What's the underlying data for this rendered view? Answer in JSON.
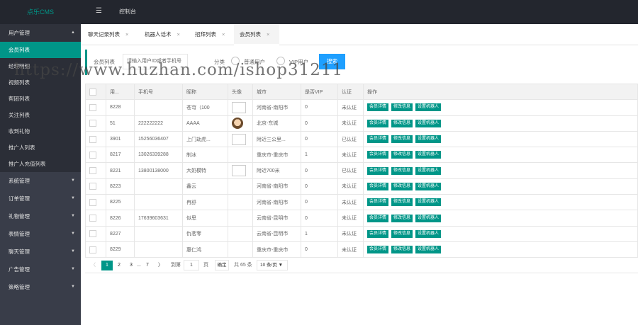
{
  "app": {
    "logo": "点乐CMS",
    "menu_icon": "☰",
    "nav_label": "控制台"
  },
  "sidebar": {
    "groups": [
      {
        "label": "用户管理",
        "open": true,
        "subs": [
          "会员列表",
          "经理明细",
          "视频列表",
          "帮团列表",
          "关注列表",
          "收到礼物",
          "推广人列表",
          "推广人充值列表"
        ]
      },
      {
        "label": "系统管理"
      },
      {
        "label": "订单管理"
      },
      {
        "label": "礼物管理"
      },
      {
        "label": "表情管理"
      },
      {
        "label": "聊天管理"
      },
      {
        "label": "广告管理"
      },
      {
        "label": "策略管理"
      }
    ]
  },
  "tabs": [
    {
      "label": "聊天记录列表",
      "close": "×"
    },
    {
      "label": "机器人话术",
      "close": "×"
    },
    {
      "label": "招拜列表",
      "close": "×"
    },
    {
      "label": "会员列表",
      "close": "×",
      "active": true
    }
  ],
  "filter": {
    "title": "会员列表",
    "placeholder": "请输入用户ID或者手机号",
    "category_label": "分类",
    "option1": "普通用户",
    "option2": "VIP用户",
    "search_btn": "搜索"
  },
  "table": {
    "headers": [
      "用...",
      "手机号",
      "昵称",
      "头像",
      "城市",
      "是否VIP",
      "认证",
      "操作"
    ],
    "actions": [
      "会员详情",
      "修改信息",
      "设置机器人"
    ],
    "rows": [
      {
        "id": "8228",
        "phone": "",
        "nick": "苍穹（100",
        "avatar": "box",
        "city": "河南省-南阳市",
        "vip": "0",
        "auth": "未认证"
      },
      {
        "id": "51",
        "phone": "222222222",
        "nick": "AAAA",
        "avatar": "face",
        "city": "北京-东城",
        "vip": "0",
        "auth": "未认证"
      },
      {
        "id": "3901",
        "phone": "15256036407",
        "nick": "上门劫虎...",
        "avatar": "box",
        "city": "附近三公里...",
        "vip": "0",
        "auth": "已认证"
      },
      {
        "id": "8217",
        "phone": "13026339288",
        "nick": "制冰",
        "avatar": "",
        "city": "重庆市-重庆市",
        "vip": "1",
        "auth": "未认证"
      },
      {
        "id": "8221",
        "phone": "13800138000",
        "nick": "大奶模特",
        "avatar": "box",
        "city": "附近700米",
        "vip": "0",
        "auth": "已认证"
      },
      {
        "id": "8223",
        "phone": "",
        "nick": "鑫云",
        "avatar": "",
        "city": "河南省-南阳市",
        "vip": "0",
        "auth": "未认证"
      },
      {
        "id": "8225",
        "phone": "",
        "nick": "冉舒",
        "avatar": "",
        "city": "河南省-南阳市",
        "vip": "0",
        "auth": "未认证"
      },
      {
        "id": "8226",
        "phone": "17639603631",
        "nick": "似思",
        "avatar": "",
        "city": "云南省-昆明市",
        "vip": "0",
        "auth": "未认证"
      },
      {
        "id": "8227",
        "phone": "",
        "nick": "仇茗零",
        "avatar": "",
        "city": "云南省-昆明市",
        "vip": "1",
        "auth": "未认证"
      },
      {
        "id": "8229",
        "phone": "",
        "nick": "惠仁鸿",
        "avatar": "",
        "city": "重庆市-重庆市",
        "vip": "0",
        "auth": "未认证"
      }
    ]
  },
  "pager": {
    "prev": "〈",
    "p1": "1",
    "p2": "2",
    "p3": "3",
    "dots": "...",
    "p7": "7",
    "next": "〉",
    "goto": "到第",
    "current": "1",
    "page_unit": "页",
    "confirm": "确定",
    "total": "共 65 条",
    "per_page": "10 条/页 ▼"
  },
  "watermark": "https://www.huzhan.com/ishop31211"
}
